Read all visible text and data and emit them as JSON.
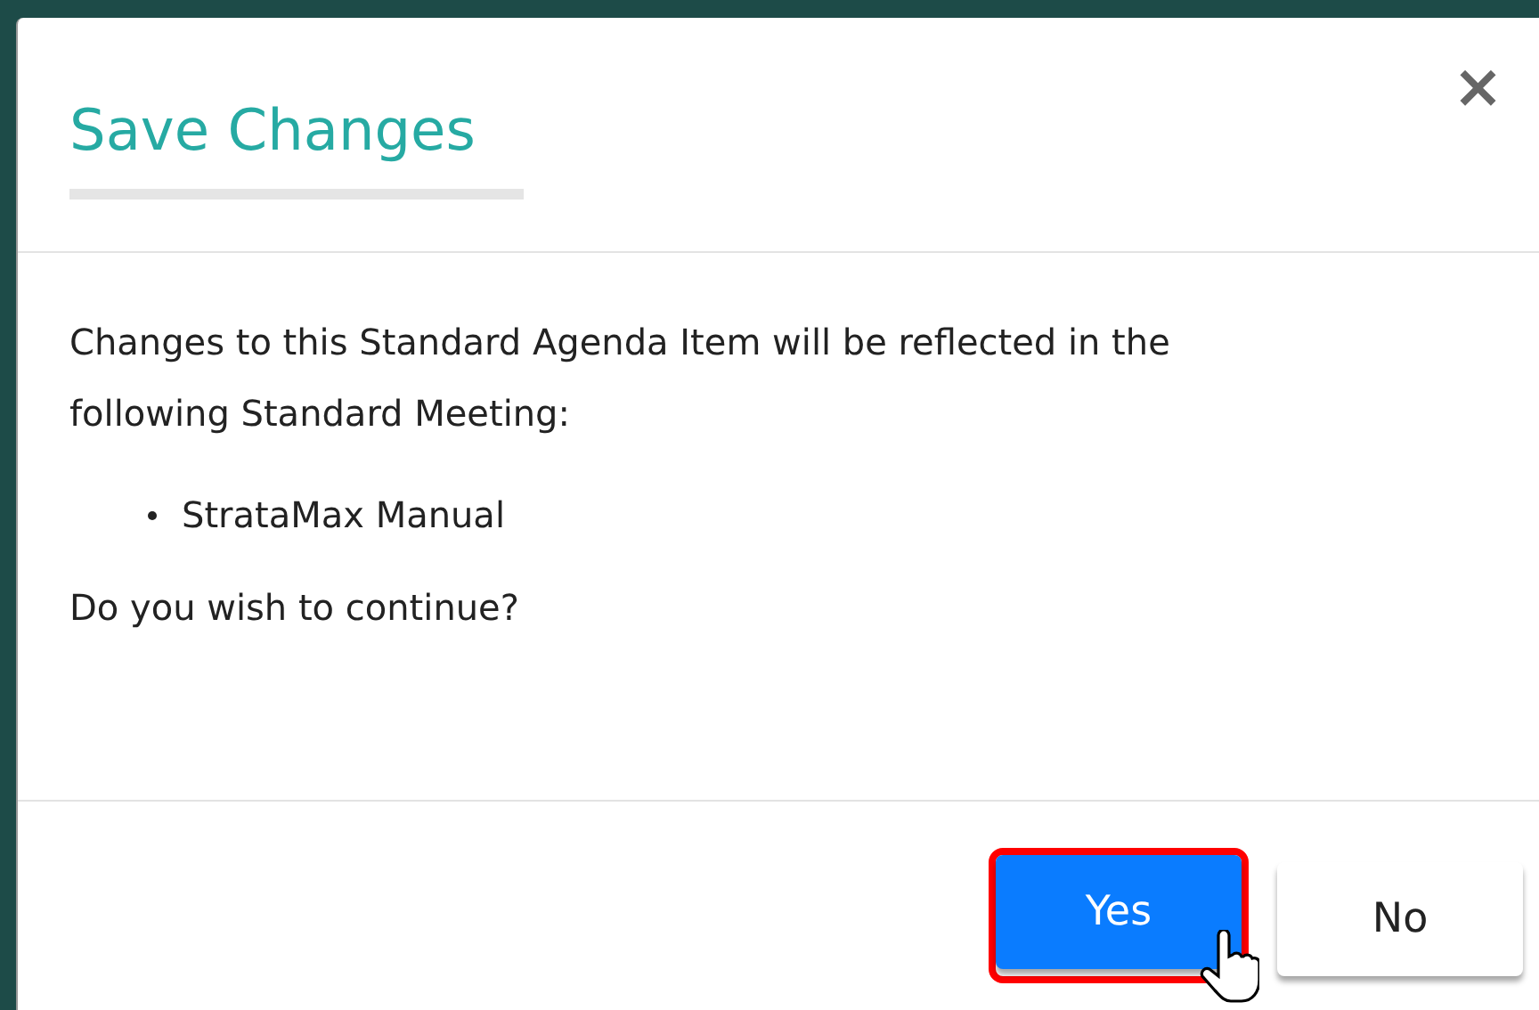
{
  "dialog": {
    "title": "Save Changes",
    "close": "×",
    "message": "Changes to this Standard Agenda Item will be reflected in the following Standard Meeting:",
    "items": [
      "StrataMax Manual"
    ],
    "question": "Do you wish to continue?",
    "buttons": [
      {
        "label": "Yes",
        "kind": "primary",
        "highlighted": true,
        "hovered": true
      },
      {
        "label": "No",
        "kind": "default",
        "highlighted": false,
        "hovered": false
      }
    ]
  }
}
